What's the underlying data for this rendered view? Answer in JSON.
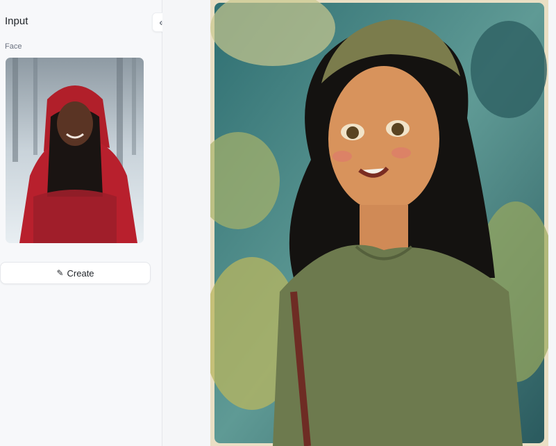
{
  "panel": {
    "title": "Input",
    "collapse_icon": "double-chevron-left-icon",
    "face_label": "Face",
    "create_label": "Create",
    "create_icon": "magic-wand-icon"
  },
  "colors": {
    "sidebar_bg": "#f7f8fa",
    "page_bg": "#f5f6f8",
    "button_bg": "#ffffff",
    "text": "#1f2328",
    "muted": "#6b7280"
  }
}
